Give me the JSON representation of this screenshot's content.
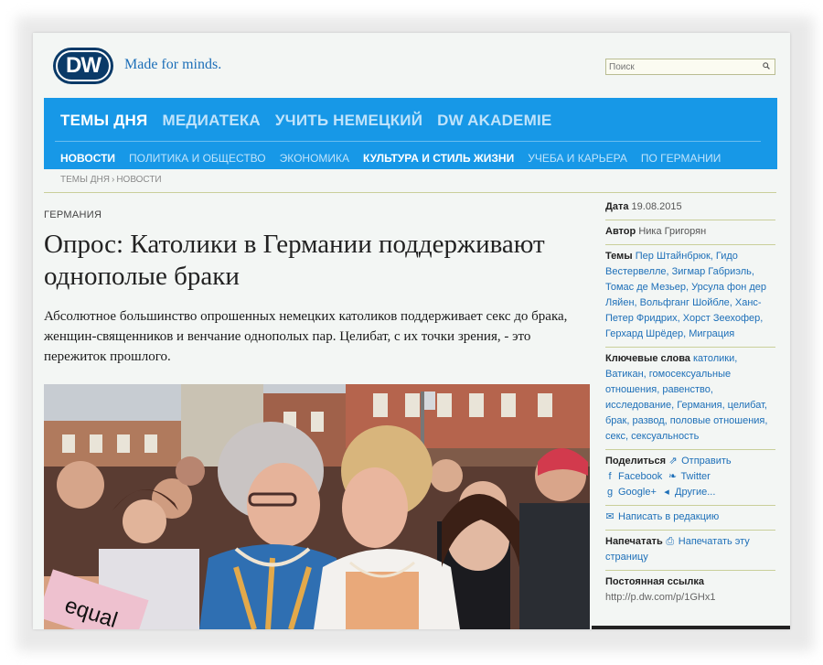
{
  "header": {
    "logo_text": "DW",
    "tagline": "Made for minds.",
    "search_placeholder": "Поиск"
  },
  "nav": {
    "main": [
      "ТЕМЫ ДНЯ",
      "МЕДИАТЕКА",
      "УЧИТЬ НЕМЕЦКИЙ",
      "DW AKADEMIE"
    ],
    "sub": [
      "НОВОСТИ",
      "ПОЛИТИКА И ОБЩЕСТВО",
      "ЭКОНОМИКА",
      "КУЛЬТУРА И СТИЛЬ ЖИЗНИ",
      "УЧЕБА И КАРЬЕРА",
      "ПО ГЕРМАНИИ"
    ]
  },
  "breadcrumb": [
    "ТЕМЫ ДНЯ",
    "НОВОСТИ"
  ],
  "article": {
    "kicker": "ГЕРМАНИЯ",
    "headline": "Опрос: Католики в Германии поддерживают однополые браки",
    "lead": "Абсолютное большинство опрошенных немецких католиков поддерживает секс до брака, женщин-священников и венчание однополых пар. Целибат, с их точки зрения, - это пережиток прошлого.",
    "photo_sign_text": "equal"
  },
  "sidebar": {
    "date_label": "Дата",
    "date_value": "19.08.2015",
    "author_label": "Автор",
    "author_value": "Ника Григорян",
    "topics_label": "Темы",
    "topics": "Пер Штайнбрюк, Гидо Вестервелле, Зигмар Габриэль, Томас де Мезьер, Урсула фон дер Ляйен, Вольфганг Шойбле, Ханс-Петер Фридрих, Хорст Зеехофер, Герхард Шрёдер, Миграция",
    "keywords_label": "Ключевые слова",
    "keywords": "католики, Ватикан, гомосексуальные отношения, равенство, исследование, Германия, целибат, брак, развод, половые отношения, секс, сексуальность",
    "share_label": "Поделиться",
    "share_send": "Отправить",
    "share_facebook": "Facebook",
    "share_twitter": "Twitter",
    "share_google": "Google+",
    "share_other": "Другие...",
    "write_editor": "Написать в редакцию",
    "print_label": "Напечатать",
    "print_link": "Напечатать эту страницу",
    "permalink_label": "Постоянная ссылка",
    "permalink": "http://p.dw.com/p/1GHx1"
  },
  "colors": {
    "nav_blue": "#1798e7",
    "link_blue": "#1d6fb8",
    "logo_navy": "#0a3a68"
  }
}
